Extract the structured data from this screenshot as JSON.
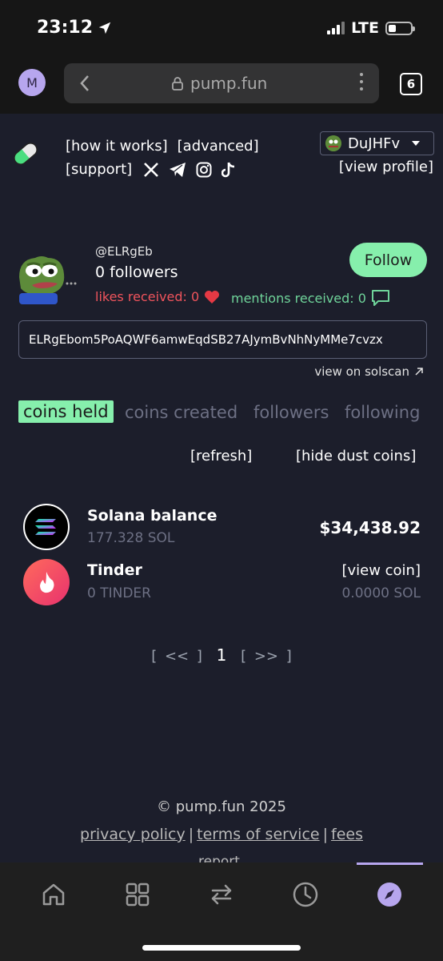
{
  "status_bar": {
    "time": "23:12",
    "network": "LTE"
  },
  "browser": {
    "avatar_letter": "M",
    "url": "pump.fun",
    "tabs_count": "6"
  },
  "header": {
    "links": [
      "[how it works]",
      "[advanced]",
      "[support]"
    ],
    "social_icons": [
      "x-icon",
      "telegram-icon",
      "instagram-icon",
      "tiktok-icon"
    ],
    "profile_button": "DuJHFv",
    "view_profile": "[view profile]"
  },
  "profile": {
    "handle": "@ELRgEb",
    "followers": "0 followers",
    "likes_received": "likes received: 0",
    "mentions_received": "mentions received: 0",
    "follow_button": "Follow",
    "address": "ELRgEbom5PoAQWF6amwEqdSB27AJymBvNhNyMMe7cvzx",
    "solscan_link": "view on solscan"
  },
  "tabs": [
    {
      "label": "coins held",
      "active": true
    },
    {
      "label": "coins created",
      "active": false
    },
    {
      "label": "followers",
      "active": false
    },
    {
      "label": "following",
      "active": false
    }
  ],
  "actions": {
    "refresh": "[refresh]",
    "hide_dust": "[hide dust coins]"
  },
  "coins": [
    {
      "name": "Solana balance",
      "amount": "177.328 SOL",
      "value": "$34,438.92",
      "value_sub": ""
    },
    {
      "name": "Tinder",
      "amount": "0 TINDER",
      "value": "[view coin]",
      "value_sub": "0.0000 SOL"
    }
  ],
  "pagination": {
    "prev": "[ << ]",
    "current": "1",
    "next": "[ >> ]"
  },
  "footer": {
    "copyright": "© pump.fun 2025",
    "links": [
      "privacy policy",
      "terms of service",
      "fees"
    ],
    "report": "report"
  },
  "bottom_nav": [
    "home-icon",
    "grid-icon",
    "swap-icon",
    "clock-icon",
    "compass-icon"
  ],
  "colors": {
    "background": "#1c1e2b",
    "accent_green": "#86efac",
    "like_red": "#f0545c",
    "mention_green": "#6fd49a",
    "nav_purple": "#b7a6ee"
  }
}
